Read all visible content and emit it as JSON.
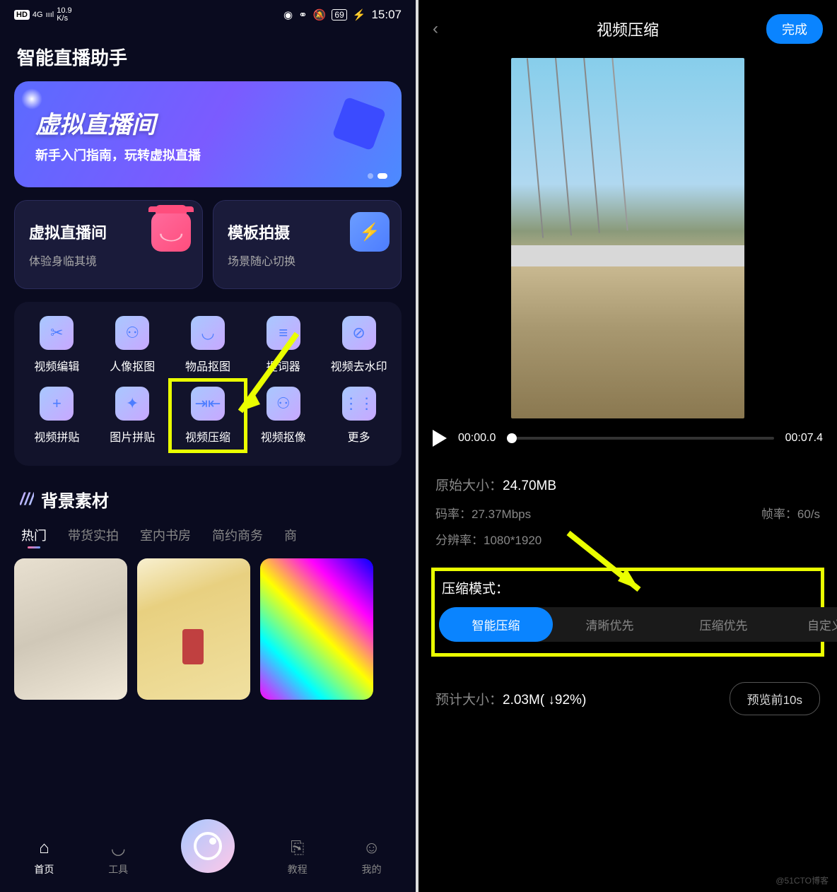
{
  "statusbar": {
    "hd": "HD",
    "net": "4G",
    "signal": "ıııl",
    "speed": "10.9\nK/s",
    "battery": "69",
    "time": "15:07"
  },
  "app_title": "智能直播助手",
  "hero": {
    "title": "虚拟直播间",
    "subtitle": "新手入门指南，玩转虚拟直播"
  },
  "cards": [
    {
      "title": "虚拟直播间",
      "sub": "体验身临其境"
    },
    {
      "title": "模板拍摄",
      "sub": "场景随心切换"
    }
  ],
  "tools": [
    {
      "label": "视频编辑",
      "icon": "✂"
    },
    {
      "label": "人像抠图",
      "icon": "⚇"
    },
    {
      "label": "物品抠图",
      "icon": "◡"
    },
    {
      "label": "提词器",
      "icon": "≡"
    },
    {
      "label": "视频去水印",
      "icon": "⊘"
    },
    {
      "label": "视频拼贴",
      "icon": "+"
    },
    {
      "label": "图片拼贴",
      "icon": "✦"
    },
    {
      "label": "视频压缩",
      "icon": "⇥⇤",
      "highlight": true
    },
    {
      "label": "视频抠像",
      "icon": "⚇"
    },
    {
      "label": "更多",
      "icon": "⋮⋮"
    }
  ],
  "section_title": "背景素材",
  "tabs": [
    "热门",
    "带货实拍",
    "室内书房",
    "简约商务",
    "商"
  ],
  "bottomnav": [
    "首页",
    "工具",
    "",
    "教程",
    "我的"
  ],
  "right": {
    "title": "视频压缩",
    "done": "完成",
    "time_start": "00:00.0",
    "time_end": "00:07.4",
    "original_label": "原始大小：",
    "original_value": "24.70MB",
    "bitrate_label": "码率：",
    "bitrate_value": "27.37Mbps",
    "fps_label": "帧率：",
    "fps_value": "60/s",
    "resolution_label": "分辨率：",
    "resolution_value": "1080*1920",
    "mode_title": "压缩模式：",
    "modes": [
      "智能压缩",
      "清晰优先",
      "压缩优先",
      "自定义模式"
    ],
    "estimate_label": "预计大小：",
    "estimate_value": "2.03M( ↓92%)",
    "preview_btn": "预览前10s"
  },
  "watermark": "@51CTO博客"
}
